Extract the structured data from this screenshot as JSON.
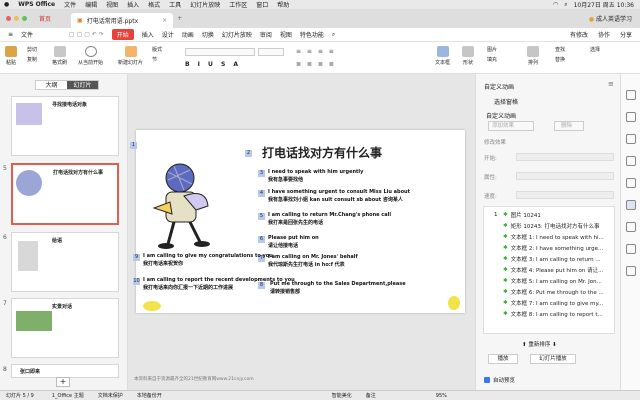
{
  "menubar": {
    "app": "WPS Office",
    "items": [
      "文件",
      "编辑",
      "视图",
      "插入",
      "格式",
      "工具",
      "幻灯片放映",
      "工作区",
      "窗口",
      "帮助"
    ],
    "clock": "10月27日 周五 10:36"
  },
  "tabs": {
    "home": "首页",
    "doc": "打电话常用语.pptx",
    "user": "成人英语学习"
  },
  "ribbon": {
    "file": "文件",
    "items": [
      "开始",
      "插入",
      "设计",
      "动画",
      "切换",
      "幻灯片放映",
      "审阅",
      "视图",
      "特色功能"
    ],
    "right": [
      "有修改",
      "协作",
      "分享"
    ]
  },
  "toolbar": {
    "paste": "粘贴",
    "cut": "剪切",
    "copy": "复制",
    "format": "格式刷",
    "play": "从当前开始",
    "new_slide": "新建幻灯片",
    "layout": "版式",
    "section": "节",
    "textbox": "文本框",
    "shapes": "形状",
    "arrange": "排列",
    "find": "查找",
    "replace": "替换",
    "select": "选择",
    "image": "图片",
    "fill": "填充"
  },
  "left_panel": {
    "tab_outline": "大纲",
    "tab_slides": "幻灯片",
    "slides": [
      {
        "num": "",
        "title": "寻找接电话对象"
      },
      {
        "num": "5",
        "title": "打电话找对方有什么事"
      },
      {
        "num": "6",
        "title": "给语"
      },
      {
        "num": "7",
        "title": "实景对话"
      },
      {
        "num": "8",
        "title": "张口即来"
      }
    ]
  },
  "slide": {
    "title": "打电话找对方有什么事",
    "items": [
      {
        "n": "2",
        "en": "",
        "cn": ""
      },
      {
        "n": "3",
        "en": "I need to speak with him urgently",
        "cn": "我有急事要找他"
      },
      {
        "n": "4",
        "en": "I have something urgent to consult Miss Liu about",
        "cn": "我有急事找刘小姐 kan sult consult sb about 咨询某人"
      },
      {
        "n": "5",
        "en": "I am calling to return Mr.Chang's phone call",
        "cn": "我打来是回张先生的电话"
      },
      {
        "n": "6",
        "en": "Please put him on",
        "cn": "请让他接电话"
      },
      {
        "n": "7",
        "en": "I am calling on Mr. Jones' behalf",
        "cn": "我代琼斯先生打电话 in ho:f 代表"
      },
      {
        "n": "9",
        "en": "I am calling to give my congratulations to you",
        "cn": "我打电话来祝贺你"
      },
      {
        "n": "10",
        "en": "I am calling to report the recent developments to you",
        "cn": "我打电话来向你汇报一下近期的工作进展"
      },
      {
        "n": "8",
        "en": "Put me through to the Sales Department,please",
        "cn": "请转接销售部"
      }
    ],
    "footer": "本资料来自于资源最齐全的21世纪教育网www.21cnjy.com"
  },
  "right_panel": {
    "title": "自定义动画",
    "select_pane": "选择窗格",
    "custom": "自定义动画",
    "add": "添加效果",
    "delete": "删除",
    "modify": "修改效果",
    "start": "开始:",
    "property": "属性:",
    "speed": "速度:",
    "items": [
      {
        "n": "1",
        "t": "图片 10241"
      },
      {
        "n": "",
        "t": "矩形 10243: 打电话找对方有什么事"
      },
      {
        "n": "",
        "t": "文本框 1: I need to speak with hi..."
      },
      {
        "n": "",
        "t": "文本框 2: I have something urge..."
      },
      {
        "n": "",
        "t": "文本框 3: I am calling to return ..."
      },
      {
        "n": "",
        "t": "文本框 4: Please put him on 请让..."
      },
      {
        "n": "",
        "t": "文本框 5: I am calling on Mr. Jon..."
      },
      {
        "n": "",
        "t": "文本框 6: Put me through to the ..."
      },
      {
        "n": "",
        "t": "文本框 7: I am calling to give my..."
      },
      {
        "n": "",
        "t": "文本框 8: I am calling to report t..."
      }
    ],
    "reorder": "重新排序",
    "play": "播放",
    "slideshow": "幻灯片播放",
    "autopreview": "自动预览"
  },
  "status": {
    "slide": "幻灯片 5 / 9",
    "theme": "1_Office 主题",
    "protect": "文档未保护",
    "backup": "本地备份开",
    "beautify": "智能美化",
    "notes": "备注",
    "zoom": "95%"
  },
  "colors": {
    "accent": "#e8403a",
    "selected": "#e06050"
  }
}
